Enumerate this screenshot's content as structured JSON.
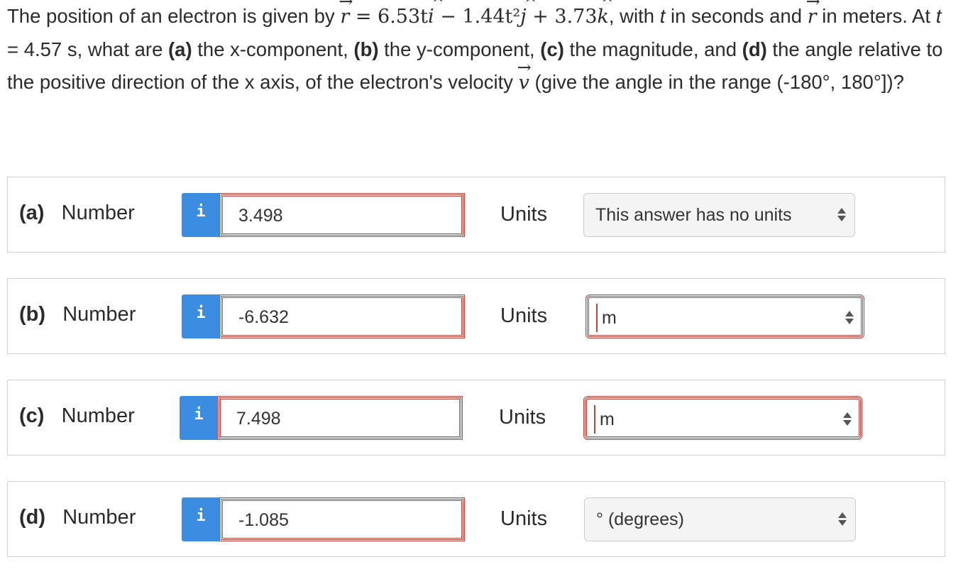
{
  "question": {
    "text_1": "The position of an electron is given by ",
    "eq_r": "r",
    "eq_equals": " = 6.53t",
    "eq_i": "i",
    "eq_minus": " − 1.44t²",
    "eq_j": "j",
    "eq_plus": " + 3.73",
    "eq_k": "k",
    "text_2": ", with ",
    "t_var": "t",
    "text_3": " in seconds and ",
    "r2": "r",
    "text_4": " in meters. At ",
    "t_var2": "t",
    "text_5": " = 4.57 s, what are ",
    "pa": "(a)",
    "text_6": " the x-component, ",
    "pb": "(b)",
    "text_7": " the y-component, ",
    "pc": "(c)",
    "text_8": " the magnitude, and ",
    "pd": "(d)",
    "text_9": " the angle relative to the positive direction of the x axis, of the electron's velocity ",
    "v": "v",
    "text_10": " (give the angle in the range (-180°, 180°])?"
  },
  "rows": [
    {
      "part": "(a)",
      "label": "Number",
      "info": "i",
      "value": "3.498",
      "units_label": "Units",
      "units_value": "This answer has no units",
      "units_error": false
    },
    {
      "part": "(b)",
      "label": "Number",
      "info": "i",
      "value": "-6.632",
      "units_label": "Units",
      "units_value": "m",
      "units_error": true
    },
    {
      "part": "(c)",
      "label": "Number",
      "info": "i",
      "value": "7.498",
      "units_label": "Units",
      "units_value": "m",
      "units_error": true
    },
    {
      "part": "(d)",
      "label": "Number",
      "info": "i",
      "value": "-1.085",
      "units_label": "Units",
      "units_value": "° (degrees)",
      "units_error": false
    }
  ],
  "colors": {
    "info_button": "#3a8de0",
    "error_border": "#b5473f",
    "row_border": "#cfcfcf"
  }
}
